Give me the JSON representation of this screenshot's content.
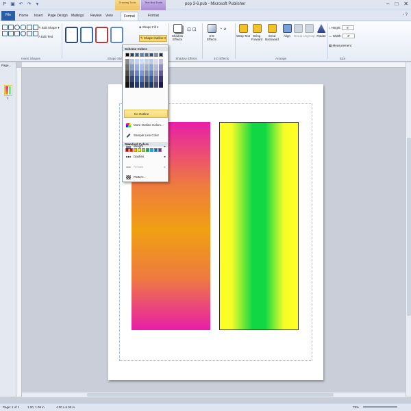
{
  "titlebar": {
    "title": "pop 3-6.pub - Microsoft Publisher",
    "context_tab_drawing": "Drawing Tools",
    "context_tab_textbox": "Text Box Tools",
    "minimize": "–",
    "maximize": "□",
    "close": "✕"
  },
  "tabs": {
    "file": "File",
    "home": "Home",
    "insert": "Insert",
    "page_design": "Page Design",
    "mailings": "Mailings",
    "review": "Review",
    "view": "View",
    "format_drawing": "Format",
    "format_text": "Format"
  },
  "ribbon": {
    "edit_shape": "Edit Shape",
    "edit_text": "Edit Text",
    "insert_shapes_label": "Insert Shapes",
    "shape_styles_label": "Shape Styles",
    "shape_fill": "Shape Fill",
    "shape_outline": "Shape Outline",
    "shadow_effects_btn": "Shadow Effects",
    "shadow_effects_label": "Shadow Effects",
    "three_d_effects_btn": "3-D Effects",
    "three_d_effects_label": "3-D Effects",
    "wrap_text": "Wrap Text",
    "bring_forward": "Bring Forward",
    "send_backward": "Send Backward",
    "align": "Align",
    "group": "Group",
    "ungroup": "Ungroup",
    "rotate": "Rotate",
    "arrange_label": "Arrange",
    "height_label": "Height:",
    "height_value": "6\"",
    "width_label": "Width:",
    "width_value": "4\"",
    "measurement": "Measurement",
    "size_label": "Size"
  },
  "pages_panel": {
    "title": "Page...",
    "page_number": "1"
  },
  "dropdown": {
    "scheme_colors": "Scheme Colors",
    "standard_colors": "Standard Colors",
    "items": [
      {
        "label": "No Outline",
        "highlighted": true,
        "disabled": false,
        "submenu": false
      },
      {
        "label": "More Outline Colors...",
        "highlighted": false,
        "disabled": false,
        "submenu": false
      },
      {
        "label": "Sample Line Color",
        "highlighted": false,
        "disabled": false,
        "submenu": false
      },
      {
        "label": "Weight",
        "highlighted": false,
        "disabled": false,
        "submenu": true
      },
      {
        "label": "Dashes",
        "highlighted": false,
        "disabled": false,
        "submenu": true
      },
      {
        "label": "Arrows",
        "highlighted": false,
        "disabled": true,
        "submenu": true
      },
      {
        "label": "Pattern...",
        "highlighted": false,
        "disabled": false,
        "submenu": false
      }
    ]
  },
  "statusbar": {
    "page": "Page: 1 of 1",
    "position": "1.20, 1.06 in.",
    "size": "4.00 x 6.00 in.",
    "zoom": "78%"
  },
  "colors": {
    "accent_file_tab": "#2a5fa8",
    "drawing_tools_tab": "#f0c25d",
    "textbox_tools_tab": "#a88bd6",
    "menu_highlight": "#f8d86c"
  }
}
